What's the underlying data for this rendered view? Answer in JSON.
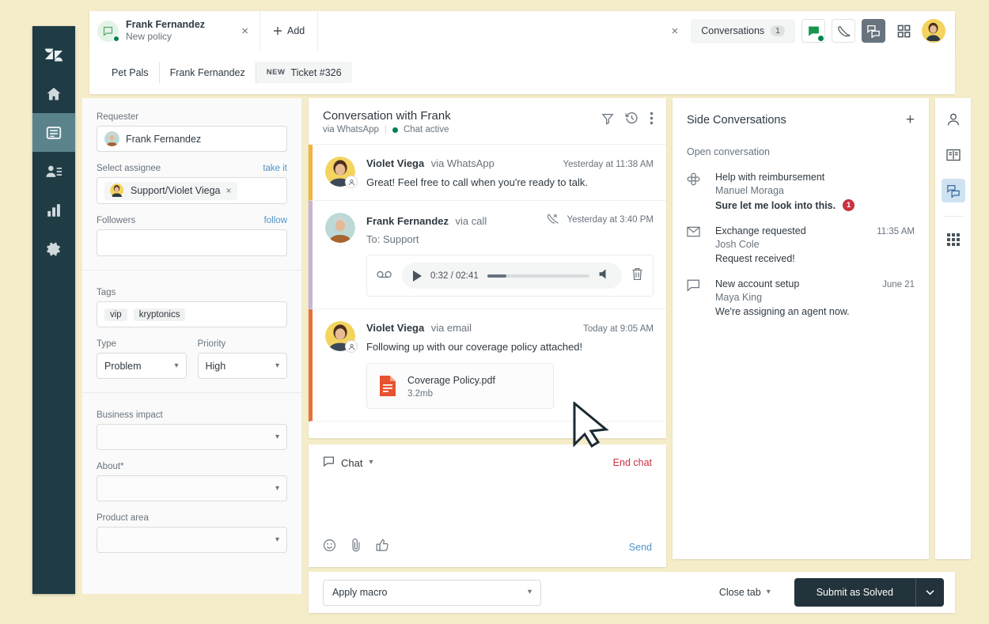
{
  "nav_rail": {
    "items": [
      {
        "name": "zendesk-logo",
        "icon": "zendesk-logo-icon",
        "active": false
      },
      {
        "name": "home",
        "icon": "home-icon",
        "active": false
      },
      {
        "name": "views",
        "icon": "views-inbox-icon",
        "active": true
      },
      {
        "name": "customers",
        "icon": "customers-icon",
        "active": false
      },
      {
        "name": "reporting",
        "icon": "bar-chart-icon",
        "active": false
      },
      {
        "name": "admin",
        "icon": "gear-icon",
        "active": false
      }
    ]
  },
  "tabbar": {
    "tab": {
      "title": "Frank Fernandez",
      "subtitle": "New policy",
      "close": "×"
    },
    "add_label": "Add",
    "add_icon": "plus-icon",
    "close_all": "×",
    "conversations_label": "Conversations",
    "conversations_count": "1",
    "icons": [
      {
        "name": "chat-status-icon",
        "selected": false
      },
      {
        "name": "phone-status-icon",
        "selected": false
      },
      {
        "name": "conversations-panel-icon",
        "selected": true
      },
      {
        "name": "apps-grid-icon",
        "selected": false
      }
    ],
    "avatar_name": "user-avatar"
  },
  "breadcrumb": {
    "items": [
      {
        "label": "Pet Pals",
        "badge": ""
      },
      {
        "label": "Frank Fernandez",
        "badge": ""
      },
      {
        "label": "Ticket #326",
        "badge": "NEW"
      }
    ]
  },
  "sidebar": {
    "requester": {
      "label": "Requester",
      "value": "Frank Fernandez"
    },
    "assignee": {
      "label": "Select assignee",
      "action": "take it",
      "value": "Support/Violet Viega",
      "remove": "×"
    },
    "followers": {
      "label": "Followers",
      "action": "follow",
      "value": ""
    },
    "tags": {
      "label": "Tags",
      "values": [
        "vip",
        "kryptonics"
      ]
    },
    "type": {
      "label": "Type",
      "value": "Problem"
    },
    "priority": {
      "label": "Priority",
      "value": "High"
    },
    "business_impact": {
      "label": "Business impact",
      "value": ""
    },
    "about": {
      "label": "About*",
      "value": ""
    },
    "product_area": {
      "label": "Product area",
      "value": ""
    }
  },
  "conversation": {
    "title": "Conversation with Frank",
    "via": "via WhatsApp",
    "status": "Chat active",
    "actions": [
      {
        "name": "filter-icon"
      },
      {
        "name": "history-icon"
      },
      {
        "name": "more-options-icon"
      }
    ],
    "messages": [
      {
        "author": "Violet Viega",
        "via": "via WhatsApp",
        "time": "Yesterday at 11:38 AM",
        "text": "Great! Feel free to call when you're ready to talk.",
        "accent": "#f5b33c",
        "avatar": "agent-avatar-violet",
        "time_icon": ""
      },
      {
        "author": "Frank Fernandez",
        "via": "via call",
        "time": "Yesterday at 3:40 PM",
        "to": "To: Support",
        "accent": "#c8b3d8",
        "avatar": "customer-avatar-frank",
        "time_icon": "missed-call-icon",
        "audio": {
          "voicemail_icon": "voicemail-icon",
          "play_icon": "play-icon",
          "time": "0:32 / 02:41",
          "progress_pct": 19,
          "volume_icon": "volume-icon",
          "delete_icon": "trash-icon"
        }
      },
      {
        "author": "Violet Viega",
        "via": "via email",
        "time": "Today at 9:05 AM",
        "text": "Following up with our coverage policy attached!",
        "accent": "#e8703a",
        "avatar": "agent-avatar-violet",
        "time_icon": "",
        "attachment": {
          "name": "Coverage Policy.pdf",
          "size": "3.2mb",
          "icon": "pdf-file-icon"
        }
      }
    ]
  },
  "composer": {
    "channel_label": "Chat",
    "channel_icon": "chat-bubble-icon",
    "end_chat_label": "End chat",
    "placeholder": "",
    "value": "",
    "tools": [
      {
        "name": "emoji-icon"
      },
      {
        "name": "attachment-clip-icon"
      },
      {
        "name": "thumbs-up-icon"
      }
    ],
    "send_label": "Send"
  },
  "side_conversations": {
    "title": "Side Conversations",
    "add_icon": "plus-icon",
    "section_label": "Open conversation",
    "items": [
      {
        "icon": "slack-icon",
        "subject": "Help with reimbursement",
        "from": "Manuel Moraga",
        "preview": "Sure let me look into this.",
        "time": "",
        "unread": true,
        "unread_count": "1"
      },
      {
        "icon": "envelope-icon",
        "subject": "Exchange requested",
        "from": "Josh Cole",
        "preview": "Request received!",
        "time": "11:35 AM",
        "unread": false,
        "unread_count": ""
      },
      {
        "icon": "ticket-chat-icon",
        "subject": "New account setup",
        "from": "Maya King",
        "preview": "We're assigning an agent now.",
        "time": "June 21",
        "unread": false,
        "unread_count": ""
      }
    ]
  },
  "right_rail": {
    "items": [
      {
        "name": "user-profile-icon",
        "selected": false
      },
      {
        "name": "knowledge-book-icon",
        "selected": false
      },
      {
        "name": "side-conversations-icon",
        "selected": true
      },
      {
        "name": "apps-grid-icon",
        "selected": false
      }
    ]
  },
  "bottombar": {
    "macro_label": "Apply macro",
    "close_tab_label": "Close tab",
    "submit_label": "Submit as Solved",
    "submit_caret": "⌄"
  },
  "colors": {
    "page_bg": "#f5ecc9",
    "nav_bg": "#1f3c45",
    "nav_active": "#5b838c",
    "accent_link": "#5293c7",
    "danger": "#cc3340",
    "success": "#038153",
    "submit_bg": "#23333b",
    "msg_accent_1": "#f5b33c",
    "msg_accent_2": "#c8b3d8",
    "msg_accent_3": "#e8703a"
  }
}
